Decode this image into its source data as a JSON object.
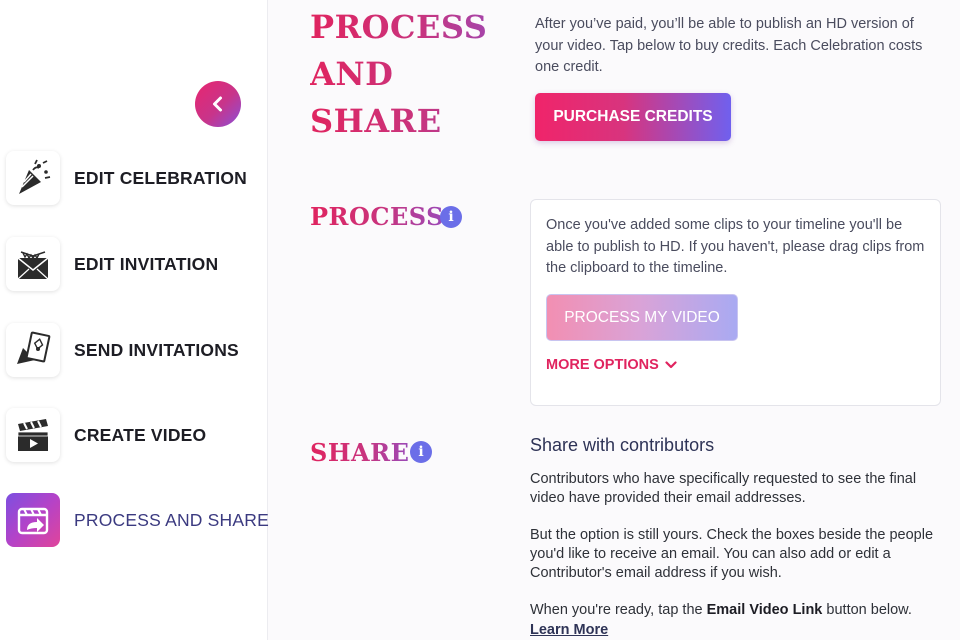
{
  "sidebar": {
    "back_icon": "chevron-left-icon",
    "items": [
      {
        "label": "EDIT CELEBRATION",
        "icon": "party-popper-icon"
      },
      {
        "label": "EDIT INVITATION",
        "icon": "envelope-invitation-icon"
      },
      {
        "label": "SEND INVITATIONS",
        "icon": "send-card-icon"
      },
      {
        "label": "CREATE VIDEO",
        "icon": "clapperboard-icon"
      },
      {
        "label": "PROCESS AND SHARE",
        "icon": "share-video-icon",
        "active": true
      }
    ]
  },
  "main": {
    "heading_lines": [
      "PROCESS",
      "AND",
      "SHARE"
    ],
    "intro": "After you’ve paid, you’ll be able to publish an HD version of your video. Tap below to buy credits. Each Celebration costs one credit.",
    "purchase_label": "PURCHASE CREDITS",
    "process": {
      "heading": "PROCESS",
      "info_glyph": "i",
      "text": "Once you've added some clips to your timeline you'll be able to publish to HD. If you haven't, please drag clips from the clipboard to the timeline.",
      "button_label": "PROCESS MY VIDEO",
      "more_options_label": "MORE OPTIONS"
    },
    "share": {
      "heading": "SHARE",
      "info_glyph": "i",
      "title": "Share with contributors",
      "p1": "Contributors who have specifically requested to see the final video have provided their email addresses.",
      "p2": "But the option is still yours. Check the boxes beside the people you'd like to receive an email. You can also add or edit a Contributor's email address if you wish.",
      "p3_before": "When you're ready, tap the ",
      "p3_bold": "Email Video Link",
      "p3_after": " button below. ",
      "learn_more": "Learn More"
    }
  },
  "colors": {
    "accent_pink": "#e0245f",
    "accent_purple": "#7060ee",
    "info_blue": "#6b6ee8"
  }
}
